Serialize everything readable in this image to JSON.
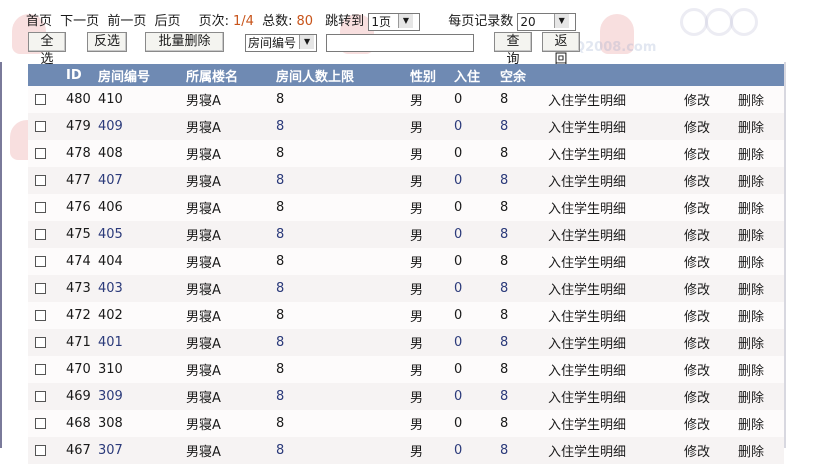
{
  "topbar": {
    "first": "首页",
    "next": "下一页",
    "prev": "前一页",
    "last": "后页",
    "page_label": "页次:",
    "page_value": "1/4",
    "total_label": "总数:",
    "total_value": "80",
    "goto_label": "跳转到",
    "goto_selected": "1页",
    "per_page_label": "每页记录数",
    "per_page_selected": "20"
  },
  "toolbar": {
    "select_all": "全选",
    "invert": "反选",
    "batch_delete": "批量删除",
    "field_selected": "房间编号",
    "search_value": "",
    "query": "查询",
    "back": "返回"
  },
  "table": {
    "headers": [
      "ID",
      "房间编号",
      "所属楼名",
      "房间人数上限",
      "性别",
      "入住",
      "空余"
    ],
    "rows": [
      {
        "id": "480",
        "num": "410",
        "bld": "男寝A",
        "max": "8",
        "sex": "男",
        "in": "0",
        "spare": "8",
        "detail": "入住学生明细",
        "edit": "修改",
        "del": "删除"
      },
      {
        "id": "479",
        "num": "409",
        "bld": "男寝A",
        "max": "8",
        "sex": "男",
        "in": "0",
        "spare": "8",
        "detail": "入住学生明细",
        "edit": "修改",
        "del": "删除"
      },
      {
        "id": "478",
        "num": "408",
        "bld": "男寝A",
        "max": "8",
        "sex": "男",
        "in": "0",
        "spare": "8",
        "detail": "入住学生明细",
        "edit": "修改",
        "del": "删除"
      },
      {
        "id": "477",
        "num": "407",
        "bld": "男寝A",
        "max": "8",
        "sex": "男",
        "in": "0",
        "spare": "8",
        "detail": "入住学生明细",
        "edit": "修改",
        "del": "删除"
      },
      {
        "id": "476",
        "num": "406",
        "bld": "男寝A",
        "max": "8",
        "sex": "男",
        "in": "0",
        "spare": "8",
        "detail": "入住学生明细",
        "edit": "修改",
        "del": "删除"
      },
      {
        "id": "475",
        "num": "405",
        "bld": "男寝A",
        "max": "8",
        "sex": "男",
        "in": "0",
        "spare": "8",
        "detail": "入住学生明细",
        "edit": "修改",
        "del": "删除"
      },
      {
        "id": "474",
        "num": "404",
        "bld": "男寝A",
        "max": "8",
        "sex": "男",
        "in": "0",
        "spare": "8",
        "detail": "入住学生明细",
        "edit": "修改",
        "del": "删除"
      },
      {
        "id": "473",
        "num": "403",
        "bld": "男寝A",
        "max": "8",
        "sex": "男",
        "in": "0",
        "spare": "8",
        "detail": "入住学生明细",
        "edit": "修改",
        "del": "删除"
      },
      {
        "id": "472",
        "num": "402",
        "bld": "男寝A",
        "max": "8",
        "sex": "男",
        "in": "0",
        "spare": "8",
        "detail": "入住学生明细",
        "edit": "修改",
        "del": "删除"
      },
      {
        "id": "471",
        "num": "401",
        "bld": "男寝A",
        "max": "8",
        "sex": "男",
        "in": "0",
        "spare": "8",
        "detail": "入住学生明细",
        "edit": "修改",
        "del": "删除"
      },
      {
        "id": "470",
        "num": "310",
        "bld": "男寝A",
        "max": "8",
        "sex": "男",
        "in": "0",
        "spare": "8",
        "detail": "入住学生明细",
        "edit": "修改",
        "del": "删除"
      },
      {
        "id": "469",
        "num": "309",
        "bld": "男寝A",
        "max": "8",
        "sex": "男",
        "in": "0",
        "spare": "8",
        "detail": "入住学生明细",
        "edit": "修改",
        "del": "删除"
      },
      {
        "id": "468",
        "num": "308",
        "bld": "男寝A",
        "max": "8",
        "sex": "男",
        "in": "0",
        "spare": "8",
        "detail": "入住学生明细",
        "edit": "修改",
        "del": "删除"
      },
      {
        "id": "467",
        "num": "307",
        "bld": "男寝A",
        "max": "8",
        "sex": "男",
        "in": "0",
        "spare": "8",
        "detail": "入住学生明细",
        "edit": "修改",
        "del": "删除"
      }
    ]
  },
  "watermark": {
    "text": "3Q2008.com"
  },
  "colors": {
    "header_bg": "#6f8ab3",
    "accent_orange": "#c8541a",
    "link_blue": "#2b3a7a"
  }
}
